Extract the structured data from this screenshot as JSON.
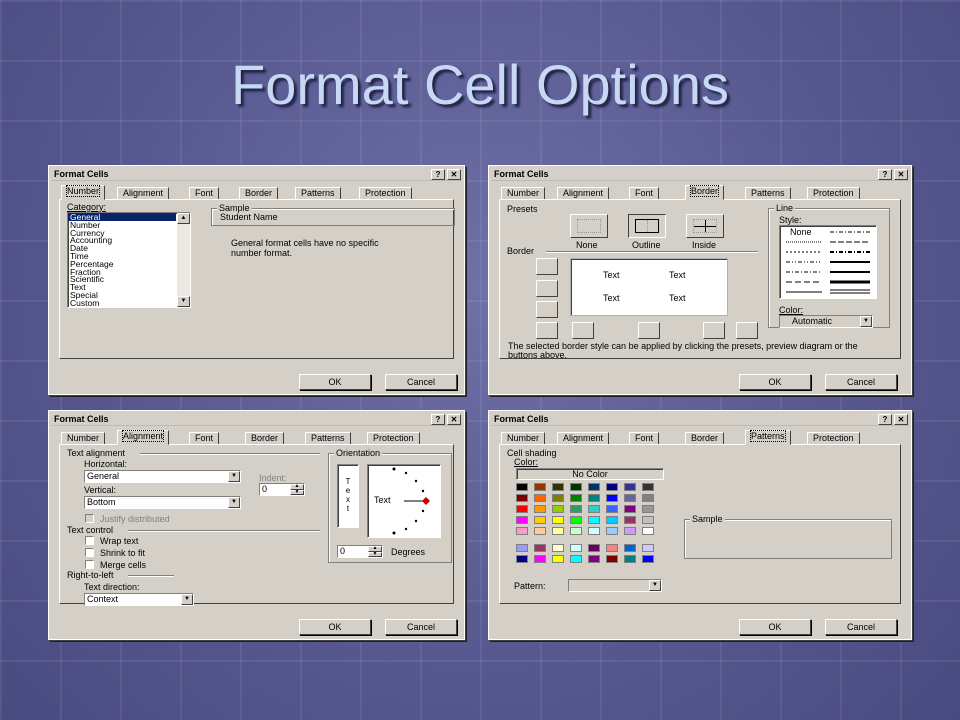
{
  "slide_title": "Format Cell Options",
  "dialog_title": "Format Cells",
  "help_glyph": "?",
  "close_glyph": "✕",
  "tabs": [
    "Number",
    "Alignment",
    "Font",
    "Border",
    "Patterns",
    "Protection"
  ],
  "ok_label": "OK",
  "cancel_label": "Cancel",
  "number_dialog": {
    "category_label": "Category:",
    "categories": [
      "General",
      "Number",
      "Currency",
      "Accounting",
      "Date",
      "Time",
      "Percentage",
      "Fraction",
      "Scientific",
      "Text",
      "Special",
      "Custom"
    ],
    "selected_category": "General",
    "sample_label": "Sample",
    "sample_value": "Student Name",
    "description": "General format cells have no specific number format."
  },
  "border_dialog": {
    "presets_label": "Presets",
    "presets": [
      "None",
      "Outline",
      "Inside"
    ],
    "border_label": "Border",
    "preview_texts": [
      "Text",
      "Text",
      "Text",
      "Text"
    ],
    "line_label": "Line",
    "style_label": "Style:",
    "style_none": "None",
    "color_label": "Color:",
    "color_value": "Automatic",
    "hint": "The selected border style can be applied by clicking the presets, preview diagram or the buttons above."
  },
  "alignment_dialog": {
    "text_alignment_label": "Text alignment",
    "horizontal_label": "Horizontal:",
    "horizontal_value": "General",
    "indent_label": "Indent:",
    "indent_value": "0",
    "vertical_label": "Vertical:",
    "vertical_value": "Bottom",
    "justify_label": "Justify distributed",
    "text_control_label": "Text control",
    "wrap_label": "Wrap text",
    "shrink_label": "Shrink to fit",
    "merge_label": "Merge cells",
    "rtl_label": "Right-to-left",
    "direction_label": "Text direction:",
    "direction_value": "Context",
    "orientation_label": "Orientation",
    "vertical_text": [
      "T",
      "e",
      "x",
      "t"
    ],
    "dial_text": "Text",
    "degrees_value": "0",
    "degrees_label": "Degrees"
  },
  "patterns_dialog": {
    "cell_shading_label": "Cell shading",
    "color_label": "Color:",
    "no_color_label": "No Color",
    "palette": [
      [
        "#000000",
        "#993300",
        "#333300",
        "#003300",
        "#003366",
        "#000080",
        "#333399",
        "#333333"
      ],
      [
        "#800000",
        "#ff6600",
        "#808000",
        "#008000",
        "#008080",
        "#0000ff",
        "#666699",
        "#808080"
      ],
      [
        "#ff0000",
        "#ff9900",
        "#99cc00",
        "#339966",
        "#33cccc",
        "#3366ff",
        "#800080",
        "#969696"
      ],
      [
        "#ff00ff",
        "#ffcc00",
        "#ffff00",
        "#00ff00",
        "#00ffff",
        "#00ccff",
        "#993366",
        "#c0c0c0"
      ],
      [
        "#ff99cc",
        "#ffcc99",
        "#ffff99",
        "#ccffcc",
        "#ccffff",
        "#99ccff",
        "#cc99ff",
        "#ffffff"
      ]
    ],
    "palette_extra": [
      [
        "#9999ff",
        "#993366",
        "#ffffcc",
        "#ccffff",
        "#660066",
        "#ff8080",
        "#0066cc",
        "#ccccff"
      ],
      [
        "#000080",
        "#ff00ff",
        "#ffff00",
        "#00ffff",
        "#800080",
        "#800000",
        "#008080",
        "#0000ff"
      ]
    ],
    "pattern_label": "Pattern:",
    "sample_label": "Sample"
  }
}
